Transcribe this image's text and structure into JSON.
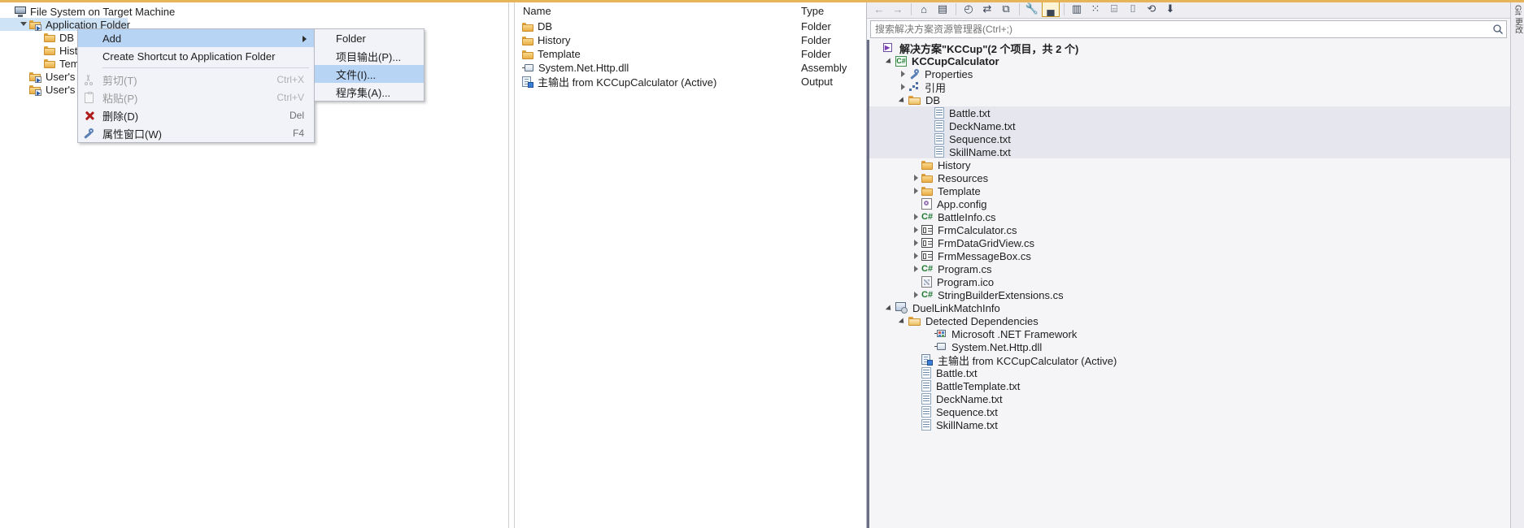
{
  "window": {
    "accent_color": "#e8b45a"
  },
  "file_system_editor": {
    "tree": [
      {
        "label": "File System on Target Machine",
        "icon": "monitor-icon",
        "indent": 0,
        "expander": "none",
        "selected": false
      },
      {
        "label": "Application Folder",
        "icon": "folder-shortcut-icon",
        "indent": 1,
        "expander": "open",
        "selected": true
      },
      {
        "label": "DB",
        "icon": "folder-icon",
        "indent": 2,
        "expander": "none",
        "selected": false
      },
      {
        "label": "History",
        "icon": "folder-icon",
        "indent": 2,
        "expander": "none",
        "selected": false
      },
      {
        "label": "Template",
        "icon": "folder-icon",
        "indent": 2,
        "expander": "none",
        "selected": false
      },
      {
        "label": "User's Desktop",
        "icon": "folder-shortcut-icon",
        "indent": 1,
        "expander": "none",
        "selected": false
      },
      {
        "label": "User's Programs Menu",
        "icon": "folder-shortcut-icon",
        "indent": 1,
        "expander": "none",
        "selected": false
      }
    ]
  },
  "context_menu": {
    "items": [
      {
        "label": "Add",
        "accel": "",
        "icon": "",
        "highlighted": true,
        "disabled": false,
        "submenu": true
      },
      {
        "label": "Create Shortcut to Application Folder",
        "accel": "",
        "icon": "",
        "highlighted": false,
        "disabled": false,
        "submenu": false
      },
      {
        "separator": true
      },
      {
        "label": "剪切(T)",
        "accel": "Ctrl+X",
        "icon": "cut-icon",
        "highlighted": false,
        "disabled": true,
        "submenu": false
      },
      {
        "label": "粘贴(P)",
        "accel": "Ctrl+V",
        "icon": "paste-icon",
        "highlighted": false,
        "disabled": true,
        "submenu": false
      },
      {
        "label": "删除(D)",
        "accel": "Del",
        "icon": "delete-icon",
        "highlighted": false,
        "disabled": false,
        "submenu": false
      },
      {
        "label": "属性窗口(W)",
        "accel": "F4",
        "icon": "properties-icon",
        "highlighted": false,
        "disabled": false,
        "submenu": false
      }
    ],
    "submenu": {
      "items": [
        {
          "label": "Folder",
          "highlighted": false
        },
        {
          "label": "项目输出(P)...",
          "highlighted": false
        },
        {
          "label": "文件(I)...",
          "highlighted": true
        },
        {
          "label": "程序集(A)...",
          "highlighted": false
        }
      ]
    }
  },
  "list_view": {
    "columns": [
      "Name",
      "Type"
    ],
    "rows": [
      {
        "name": "DB",
        "type": "Folder",
        "icon": "folder-icon"
      },
      {
        "name": "History",
        "type": "Folder",
        "icon": "folder-icon"
      },
      {
        "name": "Template",
        "type": "Folder",
        "icon": "folder-icon"
      },
      {
        "name": "System.Net.Http.dll",
        "type": "Assembly",
        "icon": "assembly-icon"
      },
      {
        "name": "主输出 from KCCupCalculator (Active)",
        "type": "Output",
        "icon": "output-icon"
      }
    ]
  },
  "solution_explorer": {
    "toolbar": [
      {
        "name": "back-icon",
        "glyph": "←",
        "active": false
      },
      {
        "name": "forward-icon",
        "glyph": "→",
        "active": false
      },
      {
        "name": "home-icon",
        "glyph": "⌂",
        "active": false
      },
      {
        "name": "solution-view-icon",
        "glyph": "▤",
        "active": false
      },
      {
        "name": "pending-changes-icon",
        "glyph": "◴",
        "active": false
      },
      {
        "name": "sync-icon",
        "glyph": "⇄",
        "active": false
      },
      {
        "name": "collapse-all-icon",
        "glyph": "⧉",
        "active": false
      },
      {
        "name": "properties-icon",
        "glyph": "🔧",
        "active": false
      },
      {
        "name": "preview-selected-items-icon",
        "glyph": "▄",
        "active": true
      },
      {
        "name": "show-all-files-icon",
        "glyph": "▥",
        "active": false
      },
      {
        "name": "add-new-item-icon",
        "glyph": "⁙",
        "active": false
      },
      {
        "name": "view-code-icon",
        "glyph": "⌸",
        "active": false
      },
      {
        "name": "view-designer-icon",
        "glyph": "⌷",
        "active": false
      },
      {
        "name": "refresh-icon",
        "glyph": "⟲",
        "active": false
      },
      {
        "name": "filter-icon",
        "glyph": "⬇",
        "active": false
      }
    ],
    "search_placeholder": "搜索解决方案资源管理器(Ctrl+;)",
    "search_value": "",
    "tree": [
      {
        "label": "解决方案\"KCCup\"(2 个项目，共 2 个)",
        "icon": "solution-icon",
        "indent": 0,
        "expander": "none",
        "bold": true,
        "selected": false
      },
      {
        "label": "KCCupCalculator",
        "icon": "csharp-project-icon",
        "indent": 1,
        "expander": "open",
        "bold": true,
        "selected": false
      },
      {
        "label": "Properties",
        "icon": "wrench-icon",
        "indent": 2,
        "expander": "closed",
        "bold": false,
        "selected": false
      },
      {
        "label": "引用",
        "icon": "references-icon",
        "indent": 2,
        "expander": "closed",
        "bold": false,
        "selected": false
      },
      {
        "label": "DB",
        "icon": "folder-open-icon",
        "indent": 2,
        "expander": "open",
        "bold": false,
        "selected": false
      },
      {
        "label": "Battle.txt",
        "icon": "txt-icon",
        "indent": 4,
        "expander": "none",
        "bold": false,
        "selected": true
      },
      {
        "label": "DeckName.txt",
        "icon": "txt-icon",
        "indent": 4,
        "expander": "none",
        "bold": false,
        "selected": true
      },
      {
        "label": "Sequence.txt",
        "icon": "txt-icon",
        "indent": 4,
        "expander": "none",
        "bold": false,
        "selected": true
      },
      {
        "label": "SkillName.txt",
        "icon": "txt-icon",
        "indent": 4,
        "expander": "none",
        "bold": false,
        "selected": true
      },
      {
        "label": "History",
        "icon": "folder-icon",
        "indent": 3,
        "expander": "none",
        "bold": false,
        "selected": false
      },
      {
        "label": "Resources",
        "icon": "folder-icon",
        "indent": 3,
        "expander": "closed",
        "bold": false,
        "selected": false
      },
      {
        "label": "Template",
        "icon": "folder-icon",
        "indent": 3,
        "expander": "closed",
        "bold": false,
        "selected": false
      },
      {
        "label": "App.config",
        "icon": "config-icon",
        "indent": 3,
        "expander": "none",
        "bold": false,
        "selected": false
      },
      {
        "label": "BattleInfo.cs",
        "icon": "csharp-file-icon",
        "indent": 3,
        "expander": "closed",
        "bold": false,
        "selected": false
      },
      {
        "label": "FrmCalculator.cs",
        "icon": "form-icon",
        "indent": 3,
        "expander": "closed",
        "bold": false,
        "selected": false
      },
      {
        "label": "FrmDataGridView.cs",
        "icon": "form-icon",
        "indent": 3,
        "expander": "closed",
        "bold": false,
        "selected": false
      },
      {
        "label": "FrmMessageBox.cs",
        "icon": "form-icon",
        "indent": 3,
        "expander": "closed",
        "bold": false,
        "selected": false
      },
      {
        "label": "Program.cs",
        "icon": "csharp-file-icon",
        "indent": 3,
        "expander": "closed",
        "bold": false,
        "selected": false
      },
      {
        "label": "Program.ico",
        "icon": "ico-icon",
        "indent": 3,
        "expander": "none",
        "bold": false,
        "selected": false
      },
      {
        "label": "StringBuilderExtensions.cs",
        "icon": "csharp-file-icon",
        "indent": 3,
        "expander": "closed",
        "bold": false,
        "selected": false
      },
      {
        "label": "DuelLinkMatchInfo",
        "icon": "setup-project-icon",
        "indent": 1,
        "expander": "open",
        "bold": false,
        "selected": false
      },
      {
        "label": "Detected Dependencies",
        "icon": "folder-open-icon",
        "indent": 2,
        "expander": "open",
        "bold": false,
        "selected": false
      },
      {
        "label": "Microsoft .NET Framework",
        "icon": "net-framework-icon",
        "indent": 4,
        "expander": "none",
        "bold": false,
        "selected": false
      },
      {
        "label": "System.Net.Http.dll",
        "icon": "assembly-icon",
        "indent": 4,
        "expander": "none",
        "bold": false,
        "selected": false
      },
      {
        "label": "主输出 from KCCupCalculator (Active)",
        "icon": "output-icon",
        "indent": 3,
        "expander": "none",
        "bold": false,
        "selected": false
      },
      {
        "label": "Battle.txt",
        "icon": "txt-icon",
        "indent": 3,
        "expander": "none",
        "bold": false,
        "selected": false
      },
      {
        "label": "BattleTemplate.txt",
        "icon": "txt-icon",
        "indent": 3,
        "expander": "none",
        "bold": false,
        "selected": false
      },
      {
        "label": "DeckName.txt",
        "icon": "txt-icon",
        "indent": 3,
        "expander": "none",
        "bold": false,
        "selected": false
      },
      {
        "label": "Sequence.txt",
        "icon": "txt-icon",
        "indent": 3,
        "expander": "none",
        "bold": false,
        "selected": false
      },
      {
        "label": "SkillName.txt",
        "icon": "txt-icon",
        "indent": 3,
        "expander": "none",
        "bold": false,
        "selected": false
      }
    ]
  },
  "right_tabs": [
    {
      "label": "Git 更改"
    }
  ]
}
